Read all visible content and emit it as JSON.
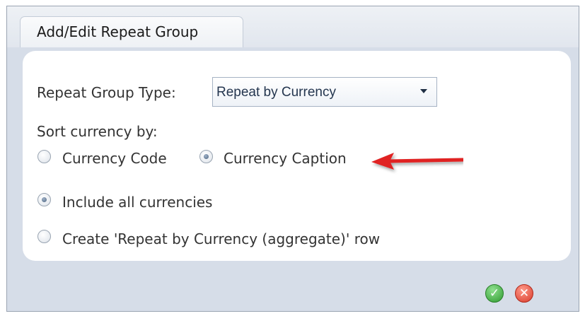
{
  "dialog": {
    "title": "Add/Edit Repeat Group"
  },
  "form": {
    "repeat_group_type_label": "Repeat Group Type:",
    "repeat_group_type_value": "Repeat by Currency",
    "sort_label": "Sort currency by:",
    "sort_options": [
      {
        "label": "Currency Code",
        "checked": false
      },
      {
        "label": "Currency Caption",
        "checked": true
      }
    ],
    "scope_options": [
      {
        "label": "Include all currencies",
        "checked": true
      },
      {
        "label": "Create 'Repeat by Currency (aggregate)' row",
        "checked": false
      }
    ]
  },
  "icons": {
    "ok": "check-icon",
    "cancel": "close-icon",
    "annotation": "red-arrow-icon"
  },
  "colors": {
    "ok": "#2f9a2f",
    "cancel": "#d83b2b",
    "annotation_arrow": "#e02020"
  }
}
